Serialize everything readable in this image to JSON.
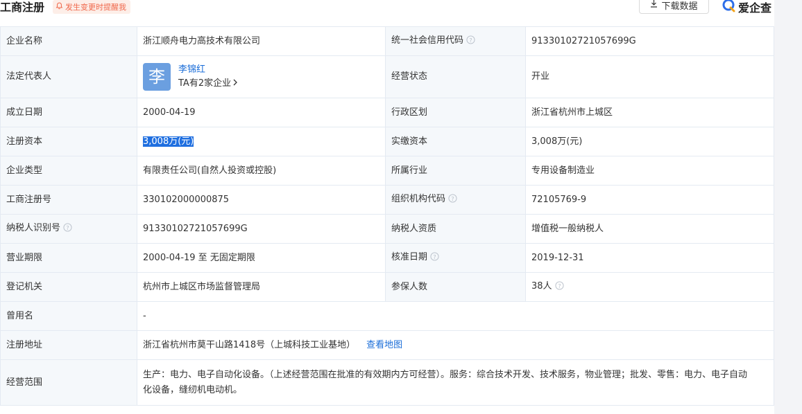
{
  "header": {
    "title": "工商注册",
    "alert_label": "发生变更时提醒我",
    "download_label": "下载数据",
    "logo_text": "爱企查"
  },
  "colors": {
    "accent": "#1a6dd8",
    "alert": "#f0674a",
    "label_bg": "#f5f8fb",
    "border": "#e4eaf2",
    "selection": "#1f6fe0"
  },
  "rows": {
    "company_name": {
      "label": "企业名称",
      "value": "浙江顺舟电力高技术有限公司"
    },
    "credit_code": {
      "label": "统一社会信用代码",
      "value": "91330102721057699G"
    },
    "legal_rep": {
      "label": "法定代表人",
      "avatar_char": "李",
      "name": "李锦红",
      "companies": "TA有2家企业"
    },
    "status": {
      "label": "经营状态",
      "value": "开业"
    },
    "founded": {
      "label": "成立日期",
      "value": "2000-04-19"
    },
    "region": {
      "label": "行政区划",
      "value": "浙江省杭州市上城区"
    },
    "reg_capital": {
      "label": "注册资本",
      "value": "3,008万(元)"
    },
    "paid_capital": {
      "label": "实缴资本",
      "value": "3,008万(元)"
    },
    "type": {
      "label": "企业类型",
      "value": "有限责任公司(自然人投资或控股)"
    },
    "industry": {
      "label": "所属行业",
      "value": "专用设备制造业"
    },
    "reg_no": {
      "label": "工商注册号",
      "value": "330102000000875"
    },
    "org_code": {
      "label": "组织机构代码",
      "value": "72105769-9"
    },
    "tax_id": {
      "label": "纳税人识别号",
      "value": "91330102721057699G"
    },
    "tax_qual": {
      "label": "纳税人资质",
      "value": "增值税一般纳税人"
    },
    "term": {
      "label": "营业期限",
      "value": "2000-04-19 至 无固定期限"
    },
    "approval": {
      "label": "核准日期",
      "value": "2019-12-31"
    },
    "authority": {
      "label": "登记机关",
      "value": "杭州市上城区市场监督管理局"
    },
    "insured": {
      "label": "参保人数",
      "value": "38人"
    },
    "former_name": {
      "label": "曾用名",
      "value": "-"
    },
    "address": {
      "label": "注册地址",
      "value": "浙江省杭州市莫干山路1418号（上城科技工业基地）",
      "map_link": "查看地图"
    },
    "scope": {
      "label": "经营范围",
      "value": "生产：电力、电子自动化设备。（上述经营范围在批准的有效期内方可经营）。服务：综合技术开发、技术服务，物业管理；批发、零售：电力、电子自动化设备，缝纫机电动机。"
    }
  }
}
